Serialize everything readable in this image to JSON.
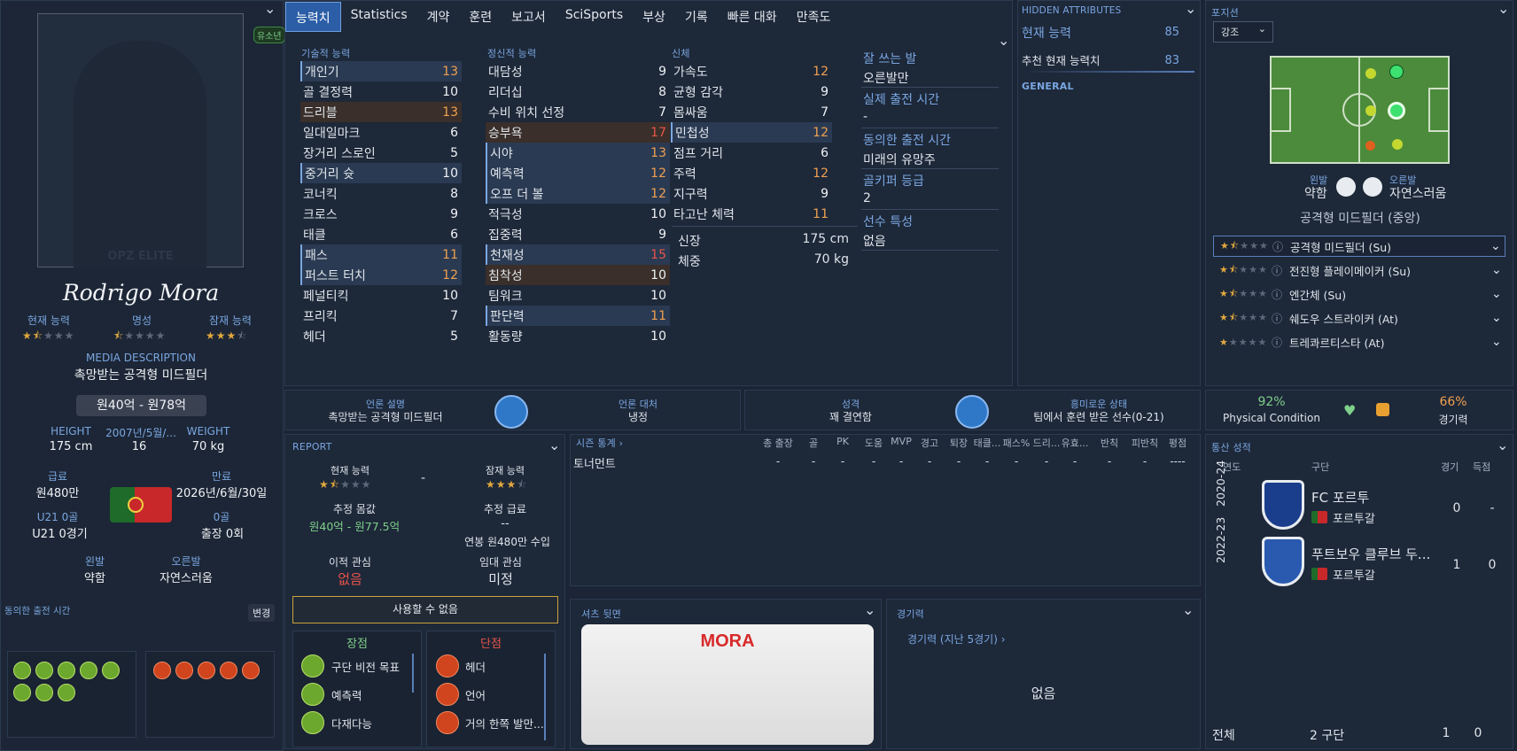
{
  "player": {
    "name": "Rodrigo Mora",
    "youth_badge": "유소년",
    "photo_watermark": "OPZ ELITE",
    "labels": {
      "current": "현재 능력",
      "reputation": "명성",
      "potential": "잠재 능력"
    },
    "media_label": "MEDIA DESCRIPTION",
    "media_desc": "촉망받는 공격형 미드필더",
    "value_range": "원40억 - 원78억",
    "height_label": "HEIGHT",
    "height": "175 cm",
    "dob_label": "2007년/5월/...",
    "age": "16",
    "weight_label": "WEIGHT",
    "weight": "70 kg",
    "wage_label": "급료",
    "wage": "원480만",
    "expiry_label": "만료",
    "expiry": "2026년/6월/30일",
    "u21goal_label": "U21 0골",
    "u21goal": "U21 0경기",
    "goals_label": "0골",
    "apps": "출장 0회",
    "left_foot_label": "왼발",
    "left_foot": "약함",
    "right_foot_label": "오른발",
    "right_foot": "자연스러움",
    "agreed_label": "동의한 출전 시간",
    "change_btn": "변경"
  },
  "tabs": [
    "능력치",
    "Statistics",
    "계약",
    "훈련",
    "보고서",
    "SciSports",
    "부상",
    "기록",
    "빠른 대화",
    "만족도"
  ],
  "attributes": {
    "technical_title": "기술적 능력",
    "mental_title": "정신적 능력",
    "physical_title": "신체",
    "technical": [
      [
        "개인기",
        "13"
      ],
      [
        "골 결정력",
        "10"
      ],
      [
        "드리블",
        "13"
      ],
      [
        "일대일마크",
        "6"
      ],
      [
        "장거리 스로인",
        "5"
      ],
      [
        "중거리 슛",
        "10"
      ],
      [
        "코너킥",
        "8"
      ],
      [
        "크로스",
        "9"
      ],
      [
        "태클",
        "6"
      ],
      [
        "패스",
        "11"
      ],
      [
        "퍼스트 터치",
        "12"
      ],
      [
        "페널티킥",
        "10"
      ],
      [
        "프리킥",
        "7"
      ],
      [
        "헤더",
        "5"
      ]
    ],
    "mental": [
      [
        "대담성",
        "9"
      ],
      [
        "리더십",
        "8"
      ],
      [
        "수비 위치 선정",
        "7"
      ],
      [
        "승부욕",
        "17"
      ],
      [
        "시야",
        "13"
      ],
      [
        "예측력",
        "12"
      ],
      [
        "오프 더 볼",
        "12"
      ],
      [
        "적극성",
        "10"
      ],
      [
        "집중력",
        "9"
      ],
      [
        "천재성",
        "15"
      ],
      [
        "침착성",
        "10"
      ],
      [
        "팀워크",
        "10"
      ],
      [
        "판단력",
        "11"
      ],
      [
        "활동량",
        "10"
      ]
    ],
    "physical": [
      [
        "가속도",
        "12"
      ],
      [
        "균형 감각",
        "9"
      ],
      [
        "몸싸움",
        "7"
      ],
      [
        "민첩성",
        "12"
      ],
      [
        "점프 거리",
        "6"
      ],
      [
        "주력",
        "12"
      ],
      [
        "지구력",
        "9"
      ],
      [
        "타고난 체력",
        "11"
      ]
    ],
    "height_label": "신장",
    "height": "175 cm",
    "weight_label": "체중",
    "weight": "70 kg"
  },
  "info": [
    {
      "label": "잘 쓰는 발",
      "value": "오른발만"
    },
    {
      "label": "실제 출전 시간",
      "value": "-"
    },
    {
      "label": "동의한 출전 시간",
      "value": "미래의 유망주"
    },
    {
      "label": "골키퍼 등급",
      "value": "2"
    },
    {
      "label": "선수 특성",
      "value": "없음"
    }
  ],
  "hidden": {
    "title": "HIDDEN ATTRIBUTES",
    "current_label": "현재 능력",
    "current": "85",
    "recommended_label": "추천 현재 능력치",
    "recommended": "83",
    "general": "GENERAL"
  },
  "position": {
    "title": "포지션",
    "select": "강조",
    "left_foot_label": "왼발",
    "left_foot": "약함",
    "right_foot_label": "오른발",
    "right_foot": "자연스러움",
    "role_name": "공격형 미드필더 (중앙)",
    "roles": [
      "공격형 미드필더 (Su)",
      "전진형 플레이메이커 (Su)",
      "엔간체 (Su)",
      "쉐도우 스트라이커 (At)",
      "트레콰르티스타 (At)"
    ]
  },
  "media": {
    "desc_label": "언론 설명",
    "desc": "촉망받는 공격형 미드필더",
    "handling_label": "언론 대처",
    "handling": "냉정",
    "personality_label": "성격",
    "personality": "꽤 결연함",
    "new_status_label": "흥미로운 상태",
    "new_status": "팀에서 훈련 받은 선수(0-21)"
  },
  "condition": {
    "physical": "92%",
    "physical_label": "Physical Condition",
    "match": "66%",
    "match_label": "경기력"
  },
  "report": {
    "title": "REPORT",
    "current_label": "현재 능력",
    "potential_label": "잠재 능력",
    "dash": "-",
    "value_label": "추정 몸값",
    "value": "원40억 - 원77.5억",
    "wage_label": "추정 급료",
    "wage": "--",
    "wage_sub": "연봉 원480만 수입",
    "transfer_label": "이적 관심",
    "transfer": "없음",
    "loan_label": "임대 관심",
    "loan": "미정",
    "unavailable": "사용할 수 없음",
    "strengths_label": "장점",
    "weaknesses_label": "단점",
    "strengths": [
      "구단 비전 목표",
      "예측력",
      "다재다능"
    ],
    "weaknesses": [
      "헤더",
      "언어",
      "거의 한쪽 발만..."
    ]
  },
  "season": {
    "title": "시즌 통계 ›",
    "cols": [
      "총 출장",
      "골",
      "PK",
      "도움",
      "MVP",
      "경고",
      "퇴장",
      "태클...",
      "패스%",
      "드리...",
      "유효...",
      "반칙",
      "피반칙",
      "평점"
    ],
    "row_label": "토너먼트",
    "row": [
      "-",
      "-",
      "-",
      "-",
      "-",
      "-",
      "-",
      "-",
      "-",
      "-",
      "-",
      "-",
      "-",
      "----"
    ]
  },
  "shirt": {
    "title": "셔츠 뒷면",
    "name": "MORA"
  },
  "form": {
    "title": "경기력",
    "sub": "경기력 (지난 5경기) ›",
    "empty": "없음"
  },
  "career": {
    "title": "통산 성적",
    "col_year": "연도",
    "col_club": "구단",
    "col_apps": "경기",
    "col_goals": "득점",
    "rows": [
      {
        "year": "2020-24",
        "club": "FC 포르투",
        "nation": "포르투갈",
        "apps": "0",
        "goals": "-"
      },
      {
        "year": "2022-23",
        "club": "푸트보우 클루브 두...",
        "nation": "포르투갈",
        "apps": "1",
        "goals": "0"
      }
    ],
    "total_label": "전체",
    "total_clubs": "2 구단",
    "total_apps": "1",
    "total_goals": "0"
  },
  "colors": {
    "accent": "#7aa6e0",
    "gold": "#e0a83e",
    "orange": "#f0a050",
    "red": "#e8544a",
    "green": "#7fd08a"
  }
}
